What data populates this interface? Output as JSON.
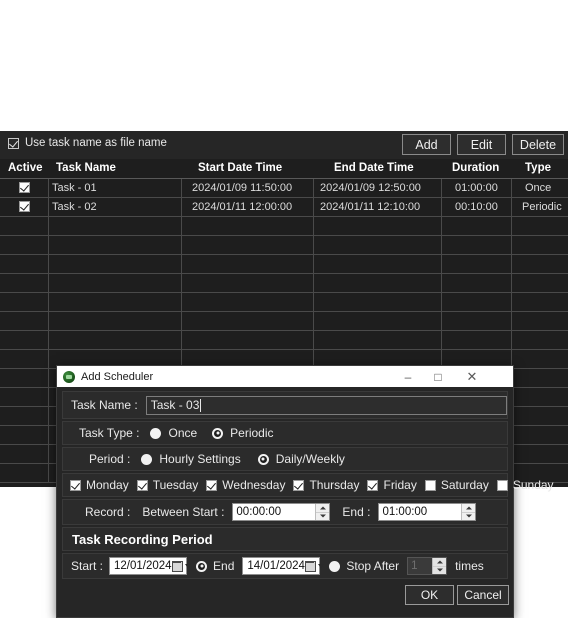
{
  "toolbar": {
    "use_task_name_label": "Use task name as file name",
    "use_task_name_checked": true,
    "add_label": "Add",
    "edit_label": "Edit",
    "delete_label": "Delete"
  },
  "table": {
    "columns": [
      "Active",
      "Task Name",
      "Start Date Time",
      "End Date Time",
      "Duration",
      "Type"
    ],
    "rows": [
      {
        "active": true,
        "task_name": "Task - 01",
        "start": "2024/01/09 11:50:00",
        "end": "2024/01/09 12:50:00",
        "duration": "01:00:00",
        "type": "Once"
      },
      {
        "active": true,
        "task_name": "Task - 02",
        "start": "2024/01/11 12:00:00",
        "end": "2024/01/11 12:10:00",
        "duration": "00:10:00",
        "type": "Periodic"
      }
    ]
  },
  "dialog": {
    "title": "Add Scheduler",
    "icon": "app-circle-icon",
    "window_controls": {
      "minimize": "–",
      "maximize": "□",
      "close": "✕"
    },
    "task_name": {
      "label": "Task Name :",
      "value": "Task - 03",
      "placeholder": ""
    },
    "task_type": {
      "label": "Task Type :",
      "options": [
        "Once",
        "Periodic"
      ],
      "selected": "Periodic"
    },
    "period": {
      "label": "Period :",
      "options": [
        "Hourly Settings",
        "Daily/Weekly"
      ],
      "selected": "Daily/Weekly"
    },
    "weekdays": [
      {
        "label": "Monday",
        "checked": true
      },
      {
        "label": "Tuesday",
        "checked": true
      },
      {
        "label": "Wednesday",
        "checked": true
      },
      {
        "label": "Thursday",
        "checked": true
      },
      {
        "label": "Friday",
        "checked": true
      },
      {
        "label": "Saturday",
        "checked": false
      },
      {
        "label": "Sunday",
        "checked": false
      }
    ],
    "record": {
      "label": "Record :",
      "between_start_label": "Between Start :",
      "start_value": "00:00:00",
      "end_label": "End :",
      "end_value": "01:00:00"
    },
    "recording_period": {
      "heading": "Task Recording Period",
      "start_label": "Start :",
      "start_value": "12/01/2024",
      "end_label": "End",
      "end_value": "14/01/2024",
      "stop_after_label": "Stop After",
      "stop_after_value": "1",
      "times_label": "times",
      "mode_selected": "End"
    },
    "ok_label": "OK",
    "cancel_label": "Cancel"
  }
}
